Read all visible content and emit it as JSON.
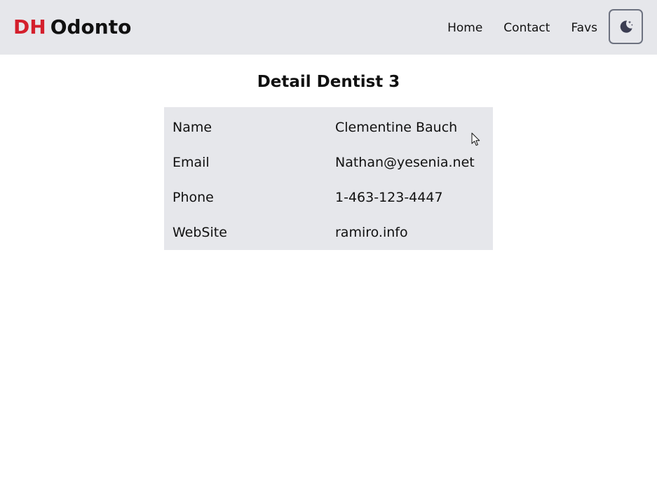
{
  "brand": {
    "accent": "DH",
    "rest": "Odonto",
    "accent_color": "#d41f2c"
  },
  "nav": {
    "links": [
      {
        "label": "Home"
      },
      {
        "label": "Contact"
      },
      {
        "label": "Favs"
      }
    ],
    "theme_toggle_icon": "moon-stars-icon"
  },
  "page": {
    "title": "Detail Dentist 3"
  },
  "dentist": {
    "rows": [
      {
        "label": "Name",
        "value": "Clementine Bauch"
      },
      {
        "label": "Email",
        "value": "Nathan@yesenia.net"
      },
      {
        "label": "Phone",
        "value": "1-463-123-4447"
      },
      {
        "label": "WebSite",
        "value": "ramiro.info"
      }
    ]
  },
  "colors": {
    "navbar_bg": "#e6e7eb",
    "table_bg": "#e6e7eb",
    "toggle_border": "#6d7280",
    "icon_color": "#3b3d52"
  }
}
